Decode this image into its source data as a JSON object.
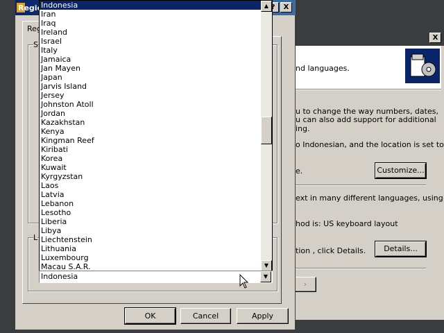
{
  "main_dialog": {
    "title": "Regio",
    "tab_label": "Reg",
    "group1_label": "S",
    "group2_label": "L",
    "buttons": {
      "ok": "OK",
      "cancel": "Cancel",
      "apply": "Apply"
    }
  },
  "country_list": {
    "selected_top": "Indonesia",
    "items": [
      "Iran",
      "Iraq",
      "Ireland",
      "Israel",
      "Italy",
      "Jamaica",
      "Jan Mayen",
      "Japan",
      "Jarvis Island",
      "Jersey",
      "Johnston Atoll",
      "Jordan",
      "Kazakhstan",
      "Kenya",
      "Kingman Reef",
      "Kiribati",
      "Korea",
      "Kuwait",
      "Kyrgyzstan",
      "Laos",
      "Latvia",
      "Lebanon",
      "Lesotho",
      "Liberia",
      "Libya",
      "Liechtenstein",
      "Lithuania",
      "Luxembourg",
      "Macau S.A.R."
    ],
    "combo_value": "Indonesia"
  },
  "back_dialog": {
    "header_text": "nd languages.",
    "para1_line1": "u to change the way numbers, dates,",
    "para1_line2": "u can also add support for additional",
    "para1_line3": "ing.",
    "para2_line1": "o Indonesian, and the location is set to",
    "para2_line2": "e.",
    "customize_button": "Customize...",
    "para3_line1": "ext in many different languages, using",
    "para3_line2": "hod is: US keyboard layout",
    "para3_line3": "tion , click Details.",
    "details_button": "Details..."
  },
  "titlebar_buttons": {
    "help": "?",
    "close": "X"
  },
  "icons": [
    "help-icon",
    "close-icon",
    "scroll-up-arrow-icon",
    "scroll-down-arrow-icon",
    "dropdown-arrow-icon",
    "regional-settings-icon",
    "mouse-cursor-icon"
  ],
  "colors": {
    "title_active": "#0a246a",
    "selection": "#0a246a",
    "face": "#d4d0c8"
  }
}
